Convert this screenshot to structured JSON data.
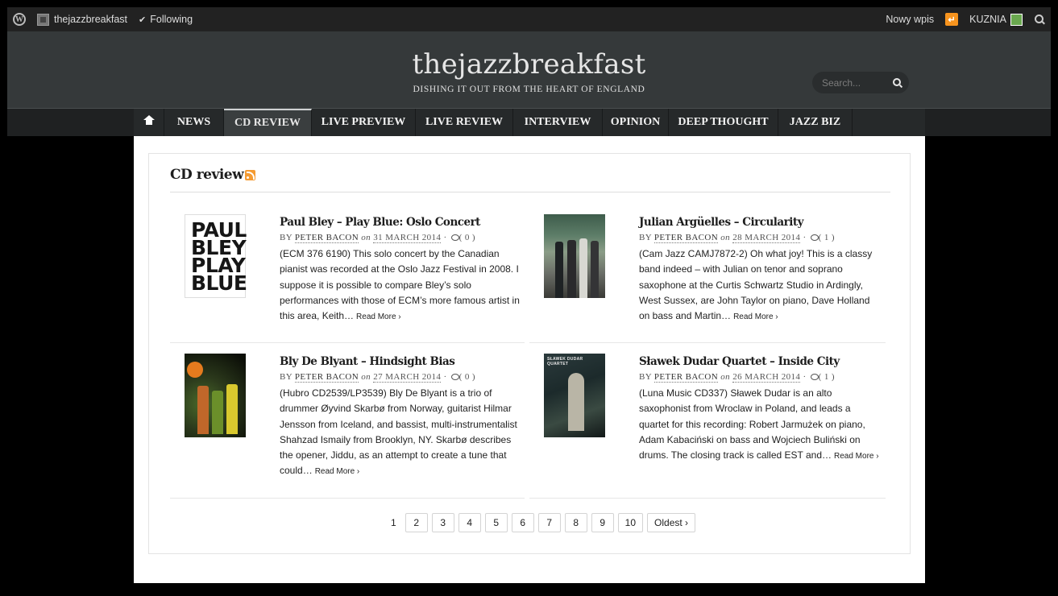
{
  "adminbar": {
    "site_name": "thejazzbreakfast",
    "following": "Following",
    "new_post": "Nowy wpis",
    "user": "KUZNIA"
  },
  "header": {
    "title": "thejazzbreakfast",
    "tagline": "DISHING IT OUT FROM THE HEART OF ENGLAND",
    "search_placeholder": "Search..."
  },
  "nav": {
    "items": [
      "NEWS",
      "CD REVIEW",
      "LIVE PREVIEW",
      "LIVE REVIEW",
      "INTERVIEW",
      "OPINION",
      "DEEP THOUGHT",
      "JAZZ BIZ"
    ],
    "active": "CD REVIEW"
  },
  "category": {
    "title": "CD review"
  },
  "posts": [
    {
      "title": "Paul Bley – Play Blue: Oslo Concert",
      "by": "BY",
      "author": "PETER BACON",
      "on": "on",
      "date": "31 MARCH 2014",
      "comments": "( 0 )",
      "excerpt": "(ECM 376 6190) This solo concert by the Canadian pianist was recorded at the Oslo Jazz Festival in 2008. I suppose it is possible to compare Bley’s solo performances with those of ECM’s more famous artist in this area, Keith…",
      "read_more": "Read More ›",
      "thumb_text": [
        "PAUL",
        "BLEY",
        "PLAY",
        "BLUE"
      ]
    },
    {
      "title": "Julian Argüelles – Circularity",
      "by": "BY",
      "author": "PETER BACON",
      "on": "on",
      "date": "28 MARCH 2014",
      "comments": "( 1 )",
      "excerpt": "(Cam Jazz CAMJ7872-2) Oh what joy! This is a classy band indeed – with Julian on tenor and soprano saxophone at the Curtis Schwartz Studio in Ardingly, West Sussex, are John Taylor on piano, Dave Holland on bass and Martin…",
      "read_more": "Read More ›"
    },
    {
      "title": "Bly De Blyant – Hindsight Bias",
      "by": "BY",
      "author": "PETER BACON",
      "on": "on",
      "date": "27 MARCH 2014",
      "comments": "( 0 )",
      "excerpt": "(Hubro CD2539/LP3539) Bly De Blyant is a trio of drummer Øyvind Skarbø from Norway, guitarist Hilmar Jensson from Iceland, and bassist, multi-instrumentalist Shahzad Ismaily from Brooklyn, NY. Skarbø describes the opener, Jiddu, as an attempt to create a tune that could…",
      "read_more": "Read More ›"
    },
    {
      "title": "Sławek Dudar Quartet – Inside City",
      "by": "BY",
      "author": "PETER BACON",
      "on": "on",
      "date": "26 MARCH 2014",
      "comments": "( 1 )",
      "excerpt": "(Luna Music CD337) Sławek Dudar is an alto saxophonist from Wroclaw in Poland, and leads a quartet for this recording: Robert Jarmużek on piano, Adam Kabaciński on bass and Wojciech Buliński on drums. The closing track is called EST and…",
      "read_more": "Read More ›",
      "thumb_text": "SŁAWEK DUDAR QUARTET"
    }
  ],
  "pagination": {
    "current": "1",
    "pages": [
      "2",
      "3",
      "4",
      "5",
      "6",
      "7",
      "8",
      "9",
      "10"
    ],
    "oldest": "Oldest ›"
  }
}
